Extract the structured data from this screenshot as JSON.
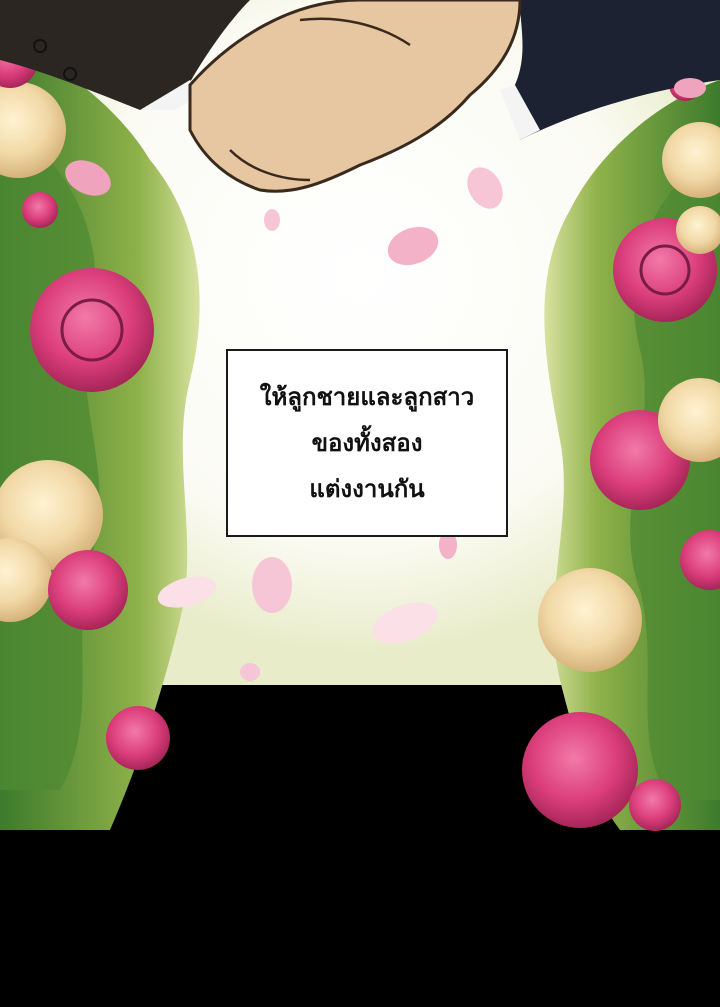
{
  "caption": {
    "lines": [
      "ให้ลูกชายและลูกสาว",
      "ของทั้งสอง",
      "แต่งงานกัน"
    ]
  },
  "colors": {
    "background": "#000000",
    "sky": "#ffffff",
    "leaf_dark": "#3f7a2e",
    "leaf_light": "#a6c45a",
    "rose_pink": "#e0457f",
    "rose_cream": "#f3deb0",
    "skin": "#e6c7a2",
    "suit_left": "#2b2622",
    "suit_right": "#1d2233",
    "petal": "#f7c6d6"
  },
  "icons": {
    "handshake": "handshake-illustration",
    "roses": "rose-bush-illustration",
    "petals": "falling-petal-illustration"
  }
}
